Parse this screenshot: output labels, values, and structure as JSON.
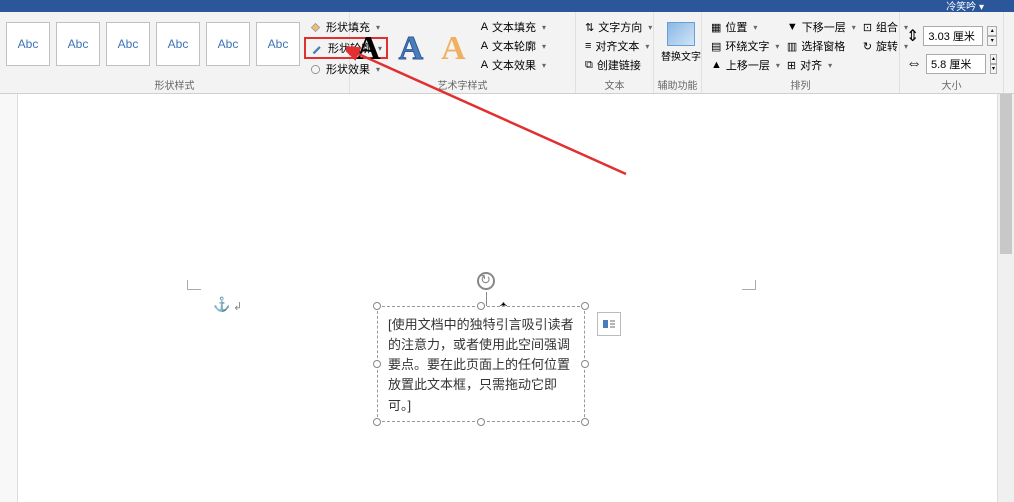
{
  "titlebar": {
    "user": "冷笑吟 ▾"
  },
  "ribbon": {
    "style_gallery": {
      "label": "形状样式",
      "items": [
        "Abc",
        "Abc",
        "Abc",
        "Abc",
        "Abc",
        "Abc"
      ]
    },
    "shape_options": {
      "fill": "形状填充",
      "outline": "形状轮廓",
      "effects": "形状效果"
    },
    "wordart": {
      "label": "艺术字样式",
      "samples": [
        "A",
        "A",
        "A"
      ],
      "text_fill": "文本填充",
      "text_outline": "文本轮廓",
      "text_effects": "文本效果"
    },
    "text_group": {
      "label": "文本",
      "direction": "文字方向",
      "align_text": "对齐文本",
      "create_link": "创建链接"
    },
    "assist": {
      "label": "辅助功能",
      "replace_text": "替换文字"
    },
    "arrange": {
      "label": "排列",
      "position": "位置",
      "wrap": "环绕文字",
      "bring_up": "上移一层",
      "send_down": "下移一层",
      "selection_pane": "选择窗格",
      "align": "对齐",
      "group": "组合",
      "rotate": "旋转"
    },
    "size": {
      "label": "大小",
      "height": "3.03 厘米",
      "width": "5.8 厘米"
    }
  },
  "textbox": {
    "content": "[使用文档中的独特引言吸引读者的注意力，或者使用此空间强调要点。要在此页面上的任何位置放置此文本框，只需拖动它即可。]"
  }
}
